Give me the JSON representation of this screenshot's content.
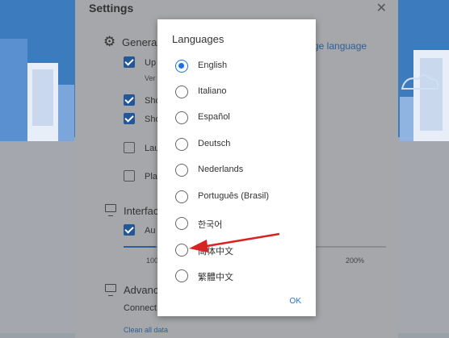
{
  "settings": {
    "title": "Settings",
    "general_label": "Genera",
    "change_language_link": "ge language",
    "options": [
      {
        "label": "Up",
        "checked": true
      },
      {
        "label": "Sho",
        "checked": true
      },
      {
        "label": "Sho",
        "checked": true
      },
      {
        "label": "Lau",
        "checked": false
      },
      {
        "label": "Pla",
        "checked": false
      }
    ],
    "version_text": "Ver",
    "interface_label": "Interfac",
    "auto_label": "Au",
    "zoom_min": "100",
    "zoom_max": "200%",
    "advanced_label": "Advanc",
    "connect_label": "Connect",
    "footer_partial": "Clean all data"
  },
  "dialog": {
    "title": "Languages",
    "languages": [
      "English",
      "Italiano",
      "Español",
      "Deutsch",
      "Nederlands",
      "Português (Brasil)",
      "한국어",
      "简体中文",
      "繁體中文"
    ],
    "selected": "English",
    "ok_label": "OK"
  },
  "colors": {
    "accent": "#1a73e8",
    "checkbox": "#24569a",
    "arrow": "#d92323"
  }
}
